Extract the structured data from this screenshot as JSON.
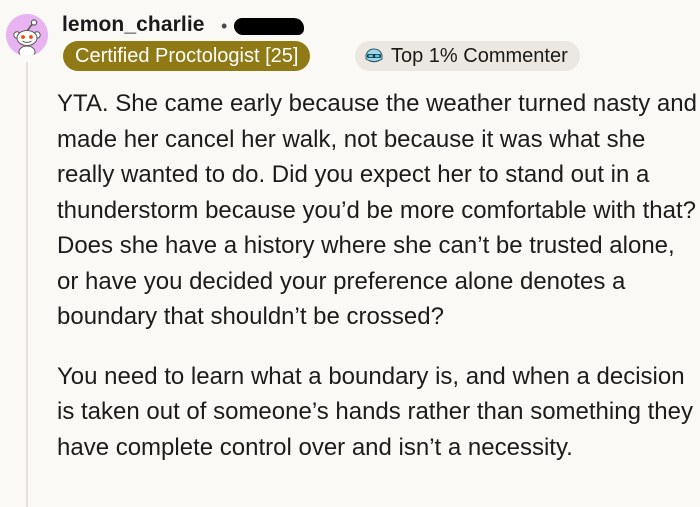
{
  "comment": {
    "author": "lemon_charlie",
    "separator": "•",
    "user_flair": "Certified Proctologist [25]",
    "badge_label": "Top 1% Commenter",
    "paragraphs": [
      "YTA. She came early because the weather turned nasty and made her cancel her walk, not because it was what she really wanted to do. Did you expect her to stand out in a thunderstorm because you’d be more comfortable with that? Does she have a history where she can’t be trusted alone, or have you decided your preference alone denotes a boundary that shouldn’t be crossed?",
      "You need to learn what a boundary is, and when a decision is taken out of someone’s hands rather than something they have complete control over and isn’t a necessity."
    ]
  },
  "colors": {
    "background": "#fbf9f5",
    "avatar": "#e7b3f0",
    "flair_background": "#8f7a16",
    "badge_background": "#ece8e1",
    "thread_line": "#e6e1da"
  },
  "icons": {
    "avatar": "snoo-avatar-icon",
    "badge": "top-commenter-icon"
  }
}
